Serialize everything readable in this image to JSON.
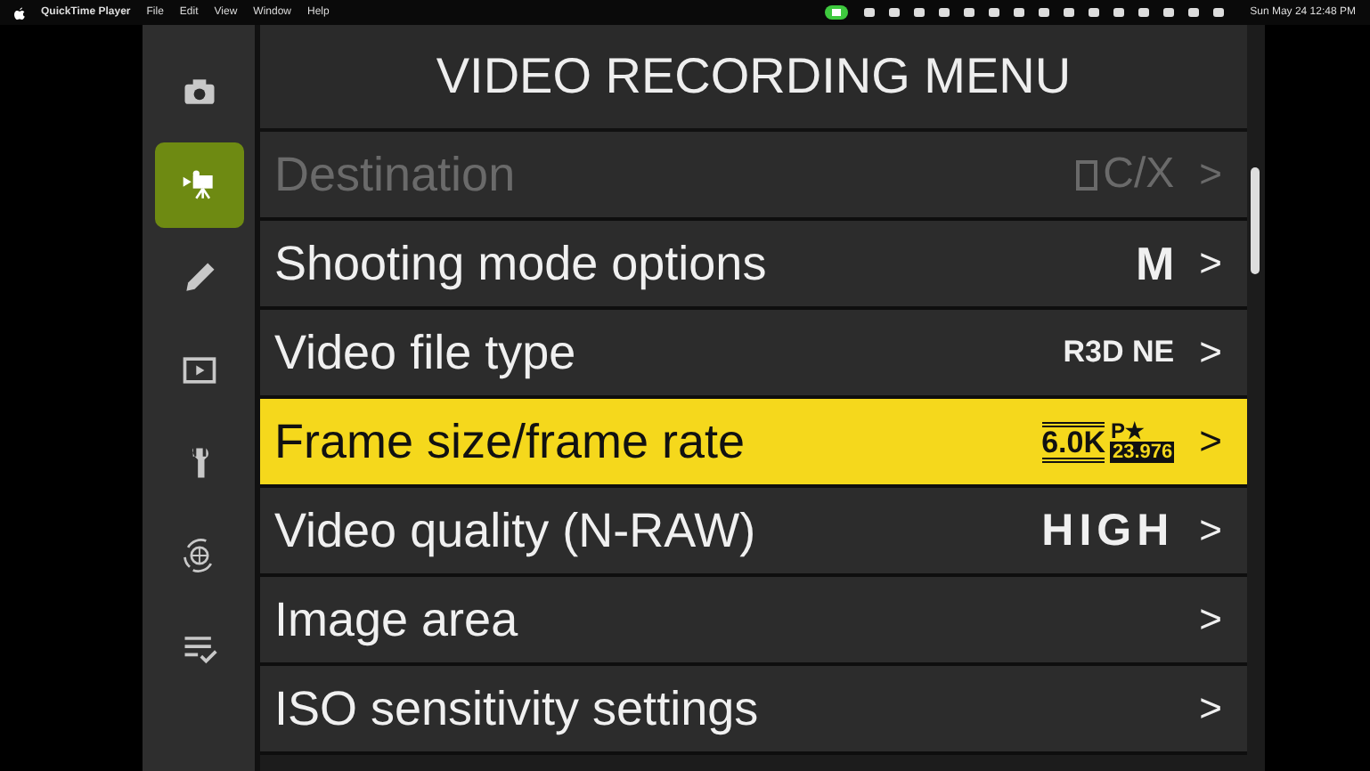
{
  "menu_bar": {
    "app": "QuickTime Player",
    "menus": [
      "File",
      "Edit",
      "View",
      "Window",
      "Help"
    ],
    "clock": "Sun May 24  12:48 PM"
  },
  "sidebar": {
    "items": [
      {
        "kind": "camera",
        "selected": false
      },
      {
        "kind": "video",
        "selected": true
      },
      {
        "kind": "pencil",
        "selected": false
      },
      {
        "kind": "playback",
        "selected": false
      },
      {
        "kind": "wrench",
        "selected": false
      },
      {
        "kind": "network",
        "selected": false
      },
      {
        "kind": "checklist",
        "selected": false
      }
    ]
  },
  "menu": {
    "title": "VIDEO RECORDING MENU",
    "rows": [
      {
        "label": "Destination",
        "kind": "card",
        "value": "C/X",
        "disabled": true,
        "selected": false,
        "arrow": ">"
      },
      {
        "label": "Shooting mode options",
        "kind": "bold",
        "value": "M",
        "disabled": false,
        "selected": false,
        "arrow": ">"
      },
      {
        "label": "Video file type",
        "kind": "small",
        "value": "R3D NE",
        "disabled": false,
        "selected": false,
        "arrow": ">"
      },
      {
        "label": "Frame size/frame rate",
        "kind": "frame",
        "value": "6.0K",
        "mode": "P★",
        "rate": "23.976",
        "disabled": false,
        "selected": true,
        "arrow": ">"
      },
      {
        "label": "Video quality (N-RAW)",
        "kind": "wide",
        "value": "HIGH",
        "disabled": false,
        "selected": false,
        "arrow": ">"
      },
      {
        "label": "Image area",
        "kind": "none",
        "disabled": false,
        "selected": false,
        "arrow": ">"
      },
      {
        "label": "ISO sensitivity settings",
        "kind": "none",
        "disabled": false,
        "selected": false,
        "arrow": ">"
      }
    ]
  }
}
